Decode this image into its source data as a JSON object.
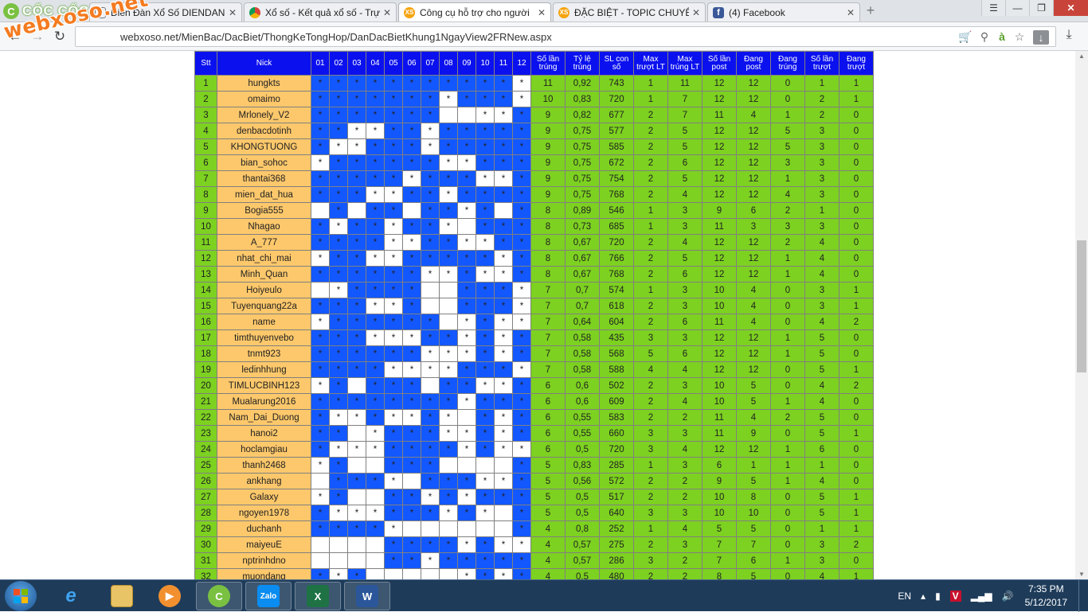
{
  "browser": {
    "brand": "CỐC CỐC",
    "tabs": [
      {
        "title": "Diễn Đàn Xổ Số DIENDAN",
        "icon": "page-icon",
        "active": false
      },
      {
        "title": "Xổ số - Kết quả xổ số - Trự",
        "icon": "chrome-icon",
        "active": false
      },
      {
        "title": "Công cụ hỗ trợ cho người",
        "icon": "xs-icon",
        "active": true
      },
      {
        "title": "ĐẶC BIỆT - TOPIC CHUYÊN",
        "icon": "xs-icon",
        "active": false
      },
      {
        "title": "(4) Facebook",
        "icon": "facebook-icon",
        "active": false
      }
    ],
    "url": "webxoso.net/MienBac/DacBiet/ThongKeTongHop/DanDacBietKhung1NgayView2FRNew.aspx",
    "watermark": "webxoso.net"
  },
  "table": {
    "headers": {
      "stt": "Stt",
      "nick": "Nick",
      "days": [
        "01",
        "02",
        "03",
        "04",
        "05",
        "06",
        "07",
        "08",
        "09",
        "10",
        "11",
        "12"
      ],
      "stats": [
        "Số lần trúng",
        "Tỷ lệ trúng",
        "SL con số",
        "Max trượt LT",
        "Max trúng LT",
        "Số lần post",
        "Đang post",
        "Đang trúng",
        "Số lần trượt",
        "Đang trượt"
      ]
    },
    "rows": [
      {
        "stt": "1",
        "nick": "hungkts",
        "pattern": "bbbbbbbbbbbw",
        "stats": [
          "11",
          "0,92",
          "743",
          "1",
          "11",
          "12",
          "12",
          "0",
          "1",
          "1"
        ]
      },
      {
        "stt": "2",
        "nick": "omaimo",
        "pattern": "bbbbbbbwbbbw",
        "stats": [
          "10",
          "0,83",
          "720",
          "1",
          "7",
          "12",
          "12",
          "0",
          "2",
          "1"
        ]
      },
      {
        "stt": "3",
        "nick": "Mrlonely_V2",
        "pattern": "bbbbbbbeewwb",
        "stats": [
          "9",
          "0,82",
          "677",
          "2",
          "7",
          "11",
          "4",
          "1",
          "2",
          "0"
        ]
      },
      {
        "stt": "4",
        "nick": "denbacdotinh",
        "pattern": "bbwwbbwbbbbb",
        "stats": [
          "9",
          "0,75",
          "577",
          "2",
          "5",
          "12",
          "12",
          "5",
          "3",
          "0"
        ]
      },
      {
        "stt": "5",
        "nick": "KHONGTUONG",
        "pattern": "bwwbbbwbbbbb",
        "stats": [
          "9",
          "0,75",
          "585",
          "2",
          "5",
          "12",
          "12",
          "5",
          "3",
          "0"
        ]
      },
      {
        "stt": "6",
        "nick": "bian_sohoc",
        "pattern": "wbbbbbbwwbbb",
        "stats": [
          "9",
          "0,75",
          "672",
          "2",
          "6",
          "12",
          "12",
          "3",
          "3",
          "0"
        ]
      },
      {
        "stt": "7",
        "nick": "thantai368",
        "pattern": "bbbbbwbbbwwb",
        "stats": [
          "9",
          "0,75",
          "754",
          "2",
          "5",
          "12",
          "12",
          "1",
          "3",
          "0"
        ]
      },
      {
        "stt": "8",
        "nick": "mien_dat_hua",
        "pattern": "bbbwwbbwbbbb",
        "stats": [
          "9",
          "0,75",
          "768",
          "2",
          "4",
          "12",
          "12",
          "4",
          "3",
          "0"
        ]
      },
      {
        "stt": "9",
        "nick": "Bogia555",
        "pattern": "ebebbebbwbeb",
        "stats": [
          "8",
          "0,89",
          "546",
          "1",
          "3",
          "9",
          "6",
          "2",
          "1",
          "0"
        ]
      },
      {
        "stt": "10",
        "nick": "Nhagao",
        "pattern": "bwbbwbbwebbb",
        "stats": [
          "8",
          "0,73",
          "685",
          "1",
          "3",
          "11",
          "3",
          "3",
          "3",
          "0"
        ]
      },
      {
        "stt": "11",
        "nick": "A_777",
        "pattern": "bbbbwwbbwwbb",
        "stats": [
          "8",
          "0,67",
          "720",
          "2",
          "4",
          "12",
          "12",
          "2",
          "4",
          "0"
        ]
      },
      {
        "stt": "12",
        "nick": "nhat_chi_mai",
        "pattern": "wbbwwbbbbbwb",
        "stats": [
          "8",
          "0,67",
          "766",
          "2",
          "5",
          "12",
          "12",
          "1",
          "4",
          "0"
        ]
      },
      {
        "stt": "13",
        "nick": "Minh_Quan",
        "pattern": "bbbbbbwwbwwb",
        "stats": [
          "8",
          "0,67",
          "768",
          "2",
          "6",
          "12",
          "12",
          "1",
          "4",
          "0"
        ]
      },
      {
        "stt": "14",
        "nick": "Hoiyeulo",
        "pattern": "ewbbbbeebbbw",
        "stats": [
          "7",
          "0,7",
          "574",
          "1",
          "3",
          "10",
          "4",
          "0",
          "3",
          "1"
        ]
      },
      {
        "stt": "15",
        "nick": "Tuyenquang22a",
        "pattern": "bbbwwbeebbbw",
        "stats": [
          "7",
          "0,7",
          "618",
          "2",
          "3",
          "10",
          "4",
          "0",
          "3",
          "1"
        ]
      },
      {
        "stt": "16",
        "nick": "name",
        "pattern": "wbbbbbbewbww",
        "stats": [
          "7",
          "0,64",
          "604",
          "2",
          "6",
          "11",
          "4",
          "0",
          "4",
          "2"
        ]
      },
      {
        "stt": "17",
        "nick": "timthuyenvebo",
        "pattern": "bbbwwwbbwbwb",
        "stats": [
          "7",
          "0,58",
          "435",
          "3",
          "3",
          "12",
          "12",
          "1",
          "5",
          "0"
        ]
      },
      {
        "stt": "18",
        "nick": "tnmt923",
        "pattern": "bbbbbbwwwbwb",
        "stats": [
          "7",
          "0,58",
          "568",
          "5",
          "6",
          "12",
          "12",
          "1",
          "5",
          "0"
        ]
      },
      {
        "stt": "19",
        "nick": "ledinhhung",
        "pattern": "bbbbwwwwbbbw",
        "stats": [
          "7",
          "0,58",
          "588",
          "4",
          "4",
          "12",
          "12",
          "0",
          "5",
          "1"
        ]
      },
      {
        "stt": "20",
        "nick": "TIMLUCBINH123",
        "pattern": "wbebbbebbwwb",
        "stats": [
          "6",
          "0,6",
          "502",
          "2",
          "3",
          "10",
          "5",
          "0",
          "4",
          "2"
        ]
      },
      {
        "stt": "21",
        "nick": "Mualarung2016",
        "pattern": "bbbbbbbbwbbb",
        "stats": [
          "6",
          "0,6",
          "609",
          "2",
          "4",
          "10",
          "5",
          "1",
          "4",
          "0"
        ]
      },
      {
        "stt": "22",
        "nick": "Nam_Dai_Duong",
        "pattern": "bwwbwwbwebwb",
        "stats": [
          "6",
          "0,55",
          "583",
          "2",
          "2",
          "11",
          "4",
          "2",
          "5",
          "0"
        ]
      },
      {
        "stt": "23",
        "nick": "hanoi2",
        "pattern": "bbewbbbwwbwb",
        "stats": [
          "6",
          "0,55",
          "660",
          "3",
          "3",
          "11",
          "9",
          "0",
          "5",
          "1"
        ]
      },
      {
        "stt": "24",
        "nick": "hoclamgiau",
        "pattern": "bwwwbbbbwbww",
        "stats": [
          "6",
          "0,5",
          "720",
          "3",
          "4",
          "12",
          "12",
          "1",
          "6",
          "0"
        ]
      },
      {
        "stt": "25",
        "nick": "thanh2468",
        "pattern": "wbeebbbeeeeb",
        "stats": [
          "5",
          "0,83",
          "285",
          "1",
          "3",
          "6",
          "1",
          "1",
          "1",
          "0"
        ]
      },
      {
        "stt": "26",
        "nick": "ankhang",
        "pattern": "ebbbwebbbwwb",
        "stats": [
          "5",
          "0,56",
          "572",
          "2",
          "2",
          "9",
          "5",
          "1",
          "4",
          "0"
        ]
      },
      {
        "stt": "27",
        "nick": "Galaxy",
        "pattern": "wbeebbwbwbbb",
        "stats": [
          "5",
          "0,5",
          "517",
          "2",
          "2",
          "10",
          "8",
          "0",
          "5",
          "1"
        ]
      },
      {
        "stt": "28",
        "nick": "ngoyen1978",
        "pattern": "bwwwbbbwbweb",
        "stats": [
          "5",
          "0,5",
          "640",
          "3",
          "3",
          "10",
          "10",
          "0",
          "5",
          "1"
        ]
      },
      {
        "stt": "29",
        "nick": "duchanh",
        "pattern": "bbbbweeeeeeb",
        "stats": [
          "4",
          "0,8",
          "252",
          "1",
          "4",
          "5",
          "5",
          "0",
          "1",
          "1"
        ]
      },
      {
        "stt": "30",
        "nick": "maiyeuE",
        "pattern": "eeeebbbbwbww",
        "stats": [
          "4",
          "0,57",
          "275",
          "2",
          "3",
          "7",
          "7",
          "0",
          "3",
          "2"
        ]
      },
      {
        "stt": "31",
        "nick": "nptrinhdno",
        "pattern": "eeeebbwbbbbb",
        "stats": [
          "4",
          "0,57",
          "286",
          "3",
          "2",
          "7",
          "6",
          "1",
          "3",
          "0"
        ]
      },
      {
        "stt": "32",
        "nick": "muondang",
        "pattern": "bwbeeeeewbwb",
        "stats": [
          "4",
          "0,5",
          "480",
          "2",
          "2",
          "8",
          "5",
          "0",
          "4",
          "1"
        ]
      }
    ]
  },
  "taskbar": {
    "apps": [
      {
        "name": "ie-icon",
        "label": "e"
      },
      {
        "name": "explorer-icon",
        "label": ""
      },
      {
        "name": "media-player-icon",
        "label": "▶"
      },
      {
        "name": "coccoc-icon",
        "label": "C"
      },
      {
        "name": "zalo-icon",
        "label": "Zalo"
      },
      {
        "name": "excel-icon",
        "label": "X"
      },
      {
        "name": "word-icon",
        "label": "W"
      }
    ],
    "language": "EN",
    "time": "7:35 PM",
    "date": "5/12/2017"
  }
}
